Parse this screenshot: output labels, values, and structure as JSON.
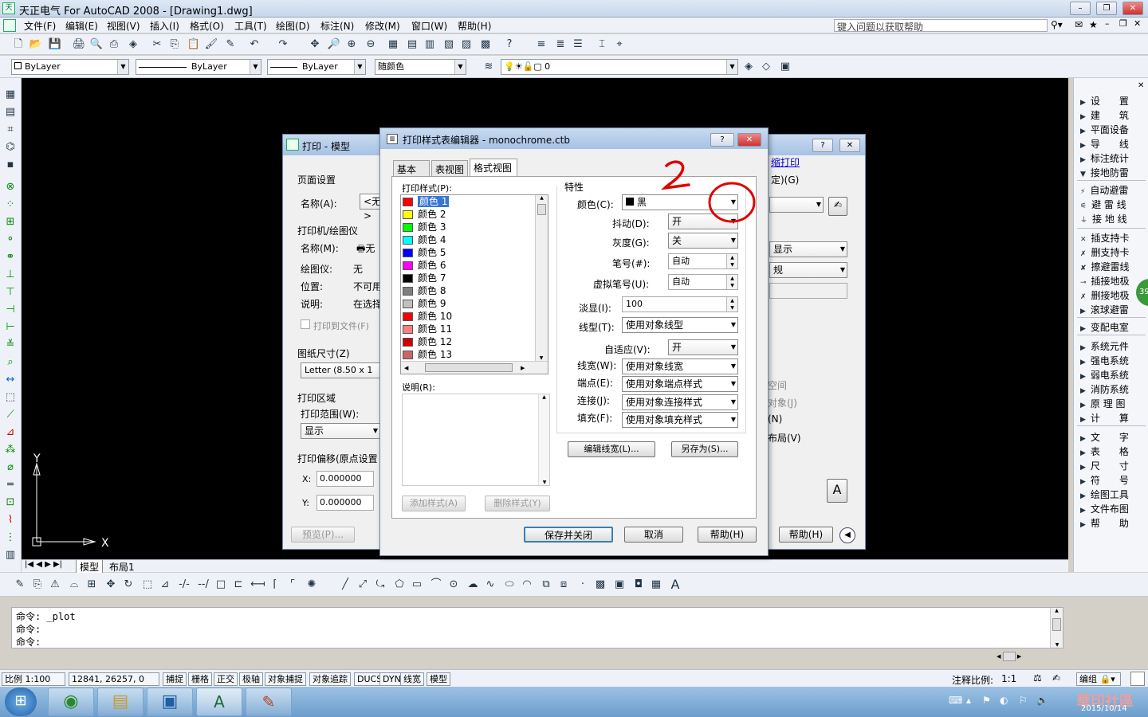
{
  "window": {
    "title": "天正电气 For AutoCAD 2008 - [Drawing1.dwg]",
    "icon": "天"
  },
  "menu": {
    "items": [
      "文件(F)",
      "编辑(E)",
      "视图(V)",
      "插入(I)",
      "格式(O)",
      "工具(T)",
      "绘图(D)",
      "标注(N)",
      "修改(M)",
      "窗口(W)",
      "帮助(H)"
    ],
    "help_placeholder": "键入问题以获取帮助"
  },
  "layerbar": {
    "color": "ByLayer",
    "linetype": "ByLayer",
    "lineweight": "ByLayer",
    "plotstyle": "随颜色",
    "layer": "0"
  },
  "rightpanel": {
    "items": [
      "设　　置",
      "建　　筑",
      "平面设备",
      "导　　线",
      "标注统计",
      "接地防雷",
      "自动避雷",
      "避 雷 线",
      "接 地 线",
      "插支持卡",
      "删支持卡",
      "擦避雷线",
      "插接地极",
      "删接地极",
      "滚球避雷",
      "变配电室",
      "系统元件",
      "强电系统",
      "弱电系统",
      "消防系统",
      "原 理 图",
      "计　　算",
      "文　　字",
      "表　　格",
      "尺　　寸",
      "符　　号",
      "绘图工具",
      "文件布图",
      "帮　　助"
    ],
    "badge": "39"
  },
  "plot_dialog": {
    "title": "打印 - 模型",
    "page_setup": "页面设置",
    "name_label": "名称(A):",
    "name_value": "<无>",
    "printer_group": "打印机/绘图仪",
    "printer_name_label": "名称(M):",
    "printer_name_value": "无",
    "plotter_label": "绘图仪:",
    "plotter_value": "无",
    "location_label": "位置:",
    "location_value": "不可用",
    "desc_label": "说明:",
    "desc_value": "在选择",
    "print_to_file": "打印到文件(F)",
    "paper_size": "图纸尺寸(Z)",
    "paper_value": "Letter (8.50 x 1",
    "plot_area": "打印区域",
    "plot_range_label": "打印范围(W):",
    "plot_range_value": "显示",
    "plot_offset": "打印偏移(原点设置",
    "x_label": "X:",
    "x_value": "0.000000",
    "y_label": "Y:",
    "y_value": "0.000000",
    "preview": "预览(P)...",
    "help": "帮助(H)",
    "right_link": "缩打印",
    "right_label": "定)(G)",
    "right_sel1": "显示",
    "right_sel2": "规",
    "right_opts": [
      "空间",
      "对象(J)",
      "(N)",
      "布局(V)"
    ]
  },
  "style_editor": {
    "title": "打印样式表编辑器 - monochrome.ctb",
    "tabs": [
      "基本",
      "表视图",
      "格式视图"
    ],
    "styles_label": "打印样式(P):",
    "styles": [
      {
        "name": "颜色 1",
        "color": "#ff0000"
      },
      {
        "name": "颜色 2",
        "color": "#ffff00"
      },
      {
        "name": "颜色 3",
        "color": "#00ff00"
      },
      {
        "name": "颜色 4",
        "color": "#00ffff"
      },
      {
        "name": "颜色 5",
        "color": "#0000ff"
      },
      {
        "name": "颜色 6",
        "color": "#ff00ff"
      },
      {
        "name": "颜色 7",
        "color": "#000000"
      },
      {
        "name": "颜色 8",
        "color": "#808080"
      },
      {
        "name": "颜色 9",
        "color": "#c0c0c0"
      },
      {
        "name": "颜色 10",
        "color": "#ff0000"
      },
      {
        "name": "颜色 11",
        "color": "#ff7f7f"
      },
      {
        "name": "颜色 12",
        "color": "#cc0000"
      },
      {
        "name": "颜色 13",
        "color": "#cc6666"
      }
    ],
    "desc_label": "说明(R):",
    "add_style": "添加样式(A)",
    "delete_style": "删除样式(Y)",
    "props_label": "特性",
    "color_label": "颜色(C):",
    "color_value": "黑",
    "dither_label": "抖动(D):",
    "dither_value": "开",
    "gray_label": "灰度(G):",
    "gray_value": "关",
    "pen_label": "笔号(#):",
    "pen_value": "自动",
    "vpen_label": "虚拟笔号(U):",
    "vpen_value": "自动",
    "screen_label": "淡显(I):",
    "screen_value": "100",
    "linetype_label": "线型(T):",
    "linetype_value": "使用对象线型",
    "adaptive_label": "自适应(V):",
    "adaptive_value": "开",
    "lineweight_label": "线宽(W):",
    "lineweight_value": "使用对象线宽",
    "endstyle_label": "端点(E):",
    "endstyle_value": "使用对象端点样式",
    "joinstyle_label": "连接(J):",
    "joinstyle_value": "使用对象连接样式",
    "fill_label": "填充(F):",
    "fill_value": "使用对象填充样式",
    "edit_lineweight": "编辑线宽(L)...",
    "save_as": "另存为(S)...",
    "save_close": "保存并关闭",
    "cancel": "取消",
    "help": "帮助(H)"
  },
  "annotation": {
    "text": "2",
    "color": "#e00000"
  },
  "layout_tabs": [
    "模型",
    "布局1"
  ],
  "command": {
    "lines": [
      "命令: _plot",
      "命令:",
      "命令:"
    ]
  },
  "status": {
    "scale": "比例 1:100",
    "coords": "12841, 26257, 0",
    "buttons": [
      "捕捉",
      "栅格",
      "正交",
      "极轴",
      "对象捕捉",
      "对象追踪",
      "DUCS",
      "DYN",
      "线宽",
      "模型"
    ],
    "annot_scale_label": "注释比例:",
    "annot_scale_value": "1:1",
    "edit": "编组"
  },
  "taskbar": {
    "clock": "2015/10/14",
    "watermark": "華印社區"
  }
}
